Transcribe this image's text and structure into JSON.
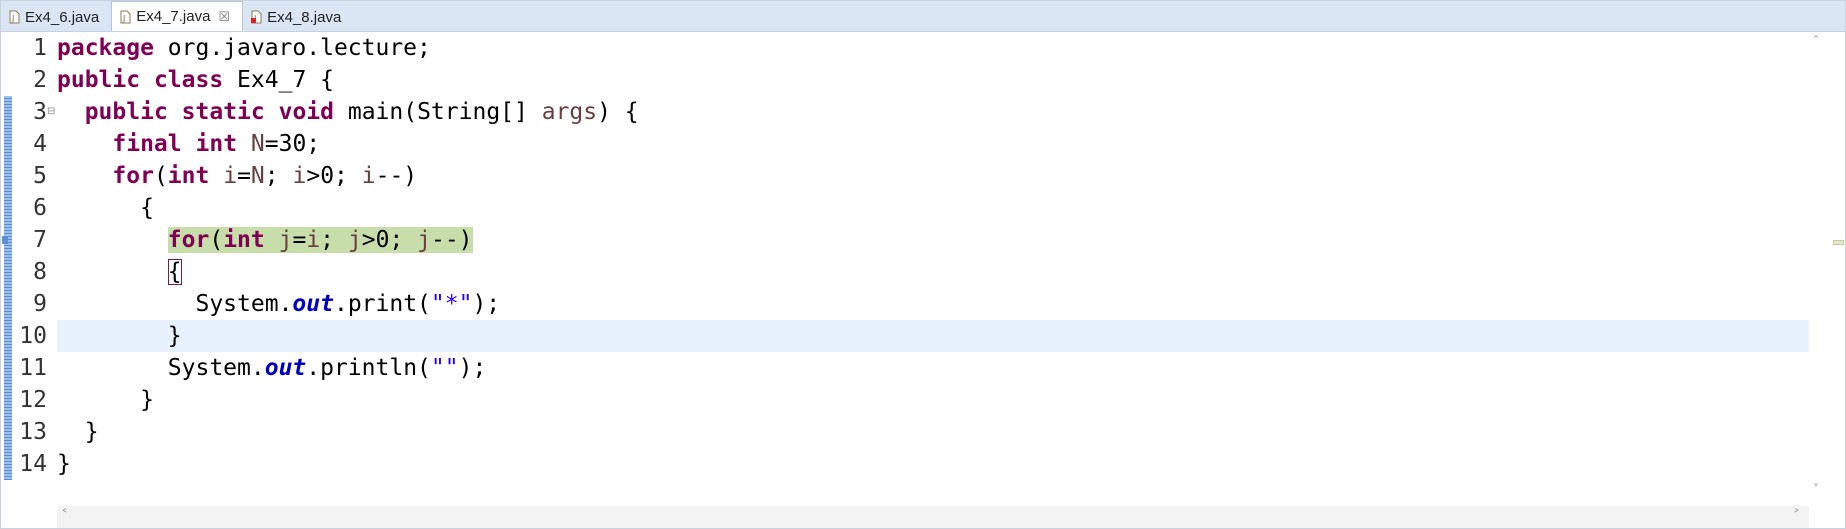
{
  "tabs": [
    {
      "label": "Ex4_6.java",
      "active": false,
      "icon": "java-file-icon"
    },
    {
      "label": "Ex4_7.java",
      "active": true,
      "icon": "java-file-icon",
      "close": "☒"
    },
    {
      "label": "Ex4_8.java",
      "active": false,
      "icon": "java-file-error-icon"
    }
  ],
  "line_numbers": [
    "1",
    "2",
    "3",
    "4",
    "5",
    "6",
    "7",
    "8",
    "9",
    "10",
    "11",
    "12",
    "13",
    "14"
  ],
  "fold_marker": "⊟",
  "code": {
    "l1": {
      "kw": "package",
      "rest": " org.javaro.lecture;"
    },
    "l2": {
      "kw1": "public",
      "kw2": "class",
      "rest": " Ex4_7 {"
    },
    "l3": {
      "indent": "  ",
      "kw1": "public",
      "kw2": "static",
      "kw3": "void",
      "rest1": " main(String[] ",
      "var": "args",
      "rest2": ") {"
    },
    "l4": {
      "indent": "    ",
      "kw1": "final",
      "kw2": "int",
      "const": "N",
      "rest": "=30;"
    },
    "l5": {
      "indent": "    ",
      "kw1": "for",
      "p1": "(",
      "kw2": "int",
      "v1": "i",
      "p2": "=",
      "c1": "N",
      "p3": "; ",
      "v2": "i",
      "p4": ">0; ",
      "v3": "i",
      "p5": "--)"
    },
    "l6": {
      "text": "      {"
    },
    "l7": {
      "indent": "        ",
      "kw1": "for",
      "p1": "(",
      "kw2": "int",
      "v1": "j",
      "p2": "=",
      "v2": "i",
      "p3": "; ",
      "v3": "j",
      "p4": ">0; ",
      "v4": "j",
      "p5": "--)"
    },
    "l8": {
      "indent": "        ",
      "brace": "{"
    },
    "l9": {
      "indent": "          ",
      "cls": "System.",
      "field": "out",
      "call": ".print(",
      "str": "\"*\"",
      "end": ");"
    },
    "l10": {
      "text": "        }"
    },
    "l11": {
      "indent": "        ",
      "cls": "System.",
      "field": "out",
      "call": ".println(",
      "str": "\"\"",
      "end": ");"
    },
    "l12": {
      "text": "      }"
    },
    "l13": {
      "text": "  }"
    },
    "l14": {
      "text": "}"
    }
  },
  "scroll": {
    "up": "˄",
    "down": "˅",
    "left": "˂",
    "right": "˃"
  }
}
